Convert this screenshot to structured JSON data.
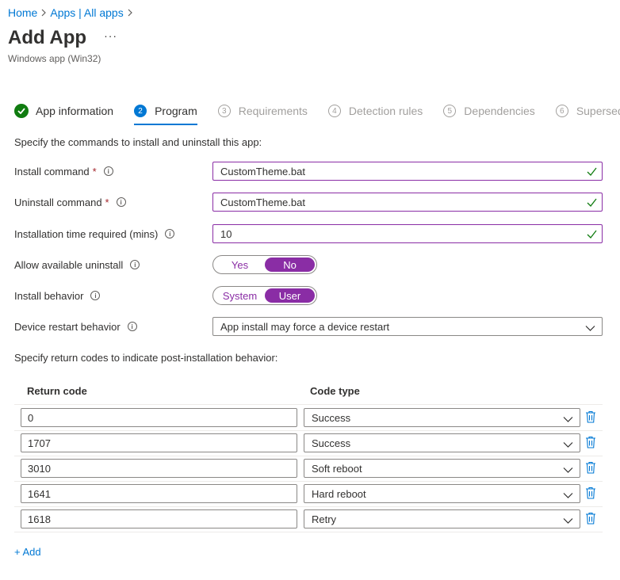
{
  "breadcrumb": [
    {
      "label": "Home"
    },
    {
      "label": "Apps | All apps"
    }
  ],
  "header": {
    "title": "Add App",
    "more": "···",
    "subtitle": "Windows app (Win32)"
  },
  "steps": [
    {
      "number": "✓",
      "label": "App information",
      "state": "done"
    },
    {
      "number": "2",
      "label": "Program",
      "state": "active"
    },
    {
      "number": "3",
      "label": "Requirements",
      "state": "pending"
    },
    {
      "number": "4",
      "label": "Detection rules",
      "state": "pending"
    },
    {
      "number": "5",
      "label": "Dependencies",
      "state": "pending"
    },
    {
      "number": "6",
      "label": "Supersedence",
      "state": "pending"
    }
  ],
  "form": {
    "intro": "Specify the commands to install and uninstall this app:",
    "install_command": {
      "label": "Install command",
      "required": "*",
      "value": "CustomTheme.bat"
    },
    "uninstall_command": {
      "label": "Uninstall command",
      "required": "*",
      "value": "CustomTheme.bat"
    },
    "install_time": {
      "label": "Installation time required (mins)",
      "value": "10"
    },
    "allow_uninstall": {
      "label": "Allow available uninstall",
      "options": [
        "Yes",
        "No"
      ],
      "selected": "No"
    },
    "install_behavior": {
      "label": "Install behavior",
      "options": [
        "System",
        "User"
      ],
      "selected": "User"
    },
    "restart_behavior": {
      "label": "Device restart behavior",
      "value": "App install may force a device restart"
    }
  },
  "return_codes": {
    "heading": "Specify return codes to indicate post-installation behavior:",
    "col_code": "Return code",
    "col_type": "Code type",
    "rows": [
      {
        "code": "0",
        "type": "Success"
      },
      {
        "code": "1707",
        "type": "Success"
      },
      {
        "code": "3010",
        "type": "Soft reboot"
      },
      {
        "code": "1641",
        "type": "Hard reboot"
      },
      {
        "code": "1618",
        "type": "Retry"
      }
    ],
    "add_label": "+ Add"
  },
  "icons": {
    "info": "info-icon",
    "check": "check-icon",
    "chevron": "chevron-down-icon",
    "delete": "trash-icon"
  },
  "colors": {
    "accent": "#8a2da5",
    "link": "#0078d4",
    "success": "#107c10",
    "required": "#a4262c"
  }
}
